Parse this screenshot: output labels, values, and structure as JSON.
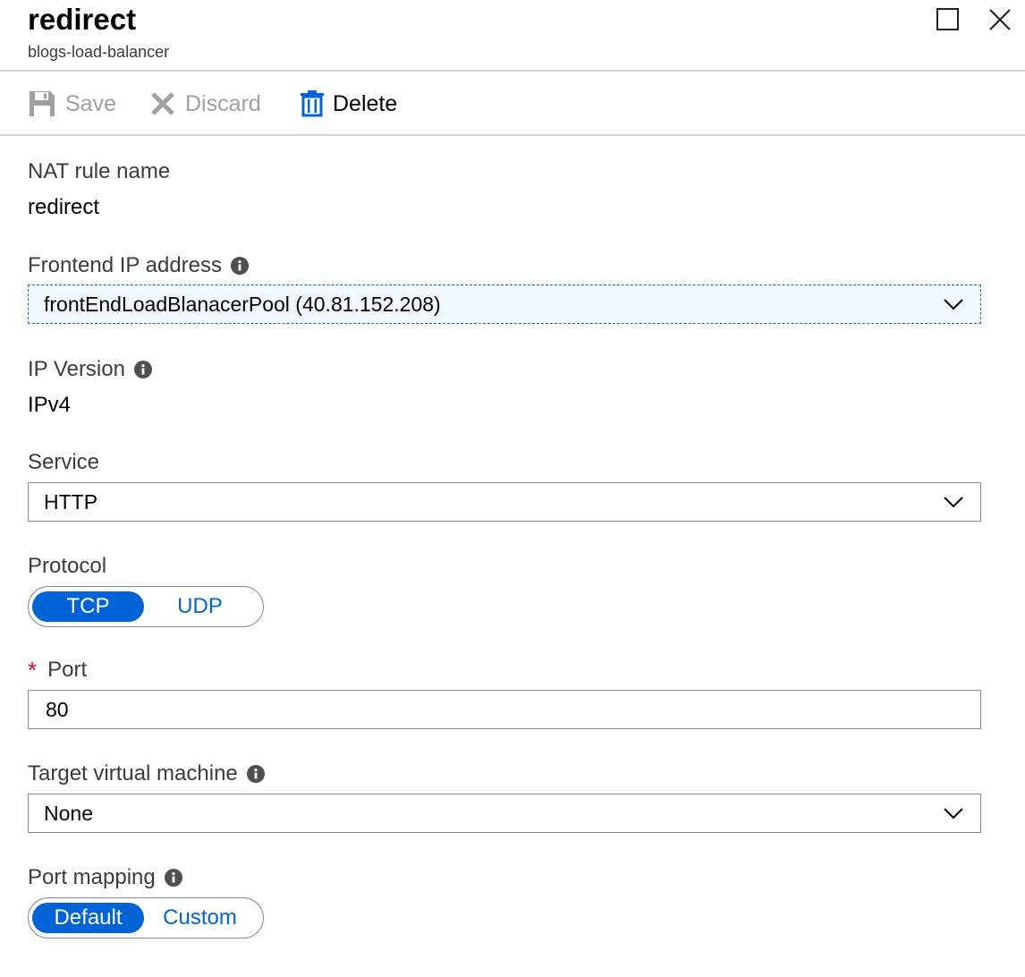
{
  "header": {
    "title": "redirect",
    "subtitle": "blogs-load-balancer"
  },
  "toolbar": {
    "save_label": "Save",
    "discard_label": "Discard",
    "delete_label": "Delete"
  },
  "form": {
    "nat_rule_name": {
      "label": "NAT rule name",
      "value": "redirect"
    },
    "frontend_ip": {
      "label": "Frontend IP address",
      "selected": "frontEndLoadBlanacerPool (40.81.152.208)"
    },
    "ip_version": {
      "label": "IP Version",
      "value": "IPv4"
    },
    "service": {
      "label": "Service",
      "selected": "HTTP"
    },
    "protocol": {
      "label": "Protocol",
      "options": [
        "TCP",
        "UDP"
      ],
      "selected": "TCP"
    },
    "port": {
      "required_mark": "*",
      "label": "Port",
      "value": "80"
    },
    "target_vm": {
      "label": "Target virtual machine",
      "selected": "None"
    },
    "port_mapping": {
      "label": "Port mapping",
      "options": [
        "Default",
        "Custom"
      ],
      "selected": "Default"
    }
  },
  "colors": {
    "accent": "#0064d6",
    "disabled_text": "#a0a0a0",
    "required": "#e00b1c",
    "focus_border": "#0a6fbf"
  },
  "icons": {
    "save": "save-icon",
    "discard": "discard-icon",
    "delete": "trash-icon",
    "info": "info-icon",
    "chevron": "chevron-down-icon",
    "maximize": "maximize-icon",
    "close": "close-icon"
  }
}
